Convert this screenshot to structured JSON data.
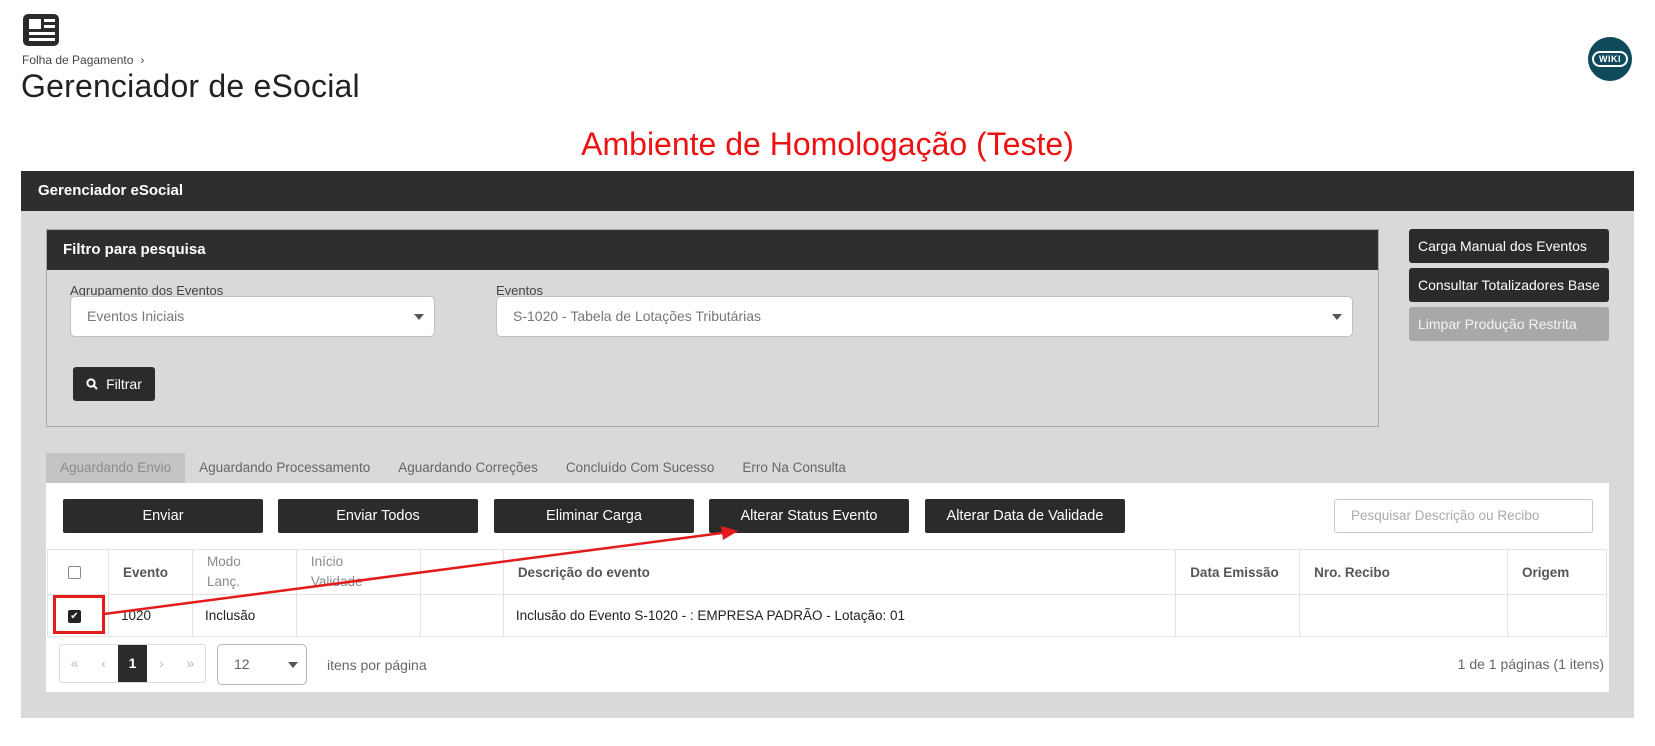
{
  "header": {
    "app_icon": "newspaper-icon",
    "breadcrumb": [
      "Folha de Pagamento"
    ],
    "page_title": "Gerenciador de eSocial",
    "wiki_label": "WIKI"
  },
  "environment_banner": {
    "text": "Ambiente de Homologação (Teste)",
    "color": "#ee1111"
  },
  "main_panel": {
    "title": "Gerenciador eSocial"
  },
  "filter": {
    "title": "Filtro para pesquisa",
    "grouping_label": "Agrupamento dos Eventos",
    "grouping_value": "Eventos Iniciais",
    "events_label": "Eventos",
    "events_value": "S-1020 - Tabela de Lotações Tributárias",
    "filter_button": "Filtrar"
  },
  "side_buttons": {
    "manual_load": "Carga Manual dos Eventos",
    "totalizers": "Consultar Totalizadores Base",
    "clear_restricted": "Limpar Produção Restrita"
  },
  "tabs": [
    {
      "label": "Aguardando Envio",
      "active": true
    },
    {
      "label": "Aguardando Processamento",
      "active": false
    },
    {
      "label": "Aguardando Correções",
      "active": false
    },
    {
      "label": "Concluído Com Sucesso",
      "active": false
    },
    {
      "label": "Erro Na Consulta",
      "active": false
    }
  ],
  "actions": {
    "send": "Enviar",
    "send_all": "Enviar Todos",
    "remove_load": "Eliminar Carga",
    "change_status": "Alterar Status Evento",
    "change_validity": "Alterar Data de Validade",
    "search_placeholder": "Pesquisar Descrição ou Recibo"
  },
  "table": {
    "columns": {
      "evento": "Evento",
      "modo": "Modo\nLanç.",
      "inicio": "Início\nValidade",
      "descricao": "Descrição do evento",
      "data_emissao": "Data Emissão",
      "nro_recibo": "Nro. Recibo",
      "origem": "Origem"
    },
    "rows": [
      {
        "checked": true,
        "evento": "1020",
        "modo": "Inclusão",
        "inicio": "",
        "descricao": "Inclusão do Evento S-1020 - : EMPRESA PADRÃO - Lotação: 01",
        "data_emissao": "",
        "nro_recibo": "",
        "origem": ""
      }
    ]
  },
  "pagination": {
    "first": "«",
    "prev": "‹",
    "current_page": "1",
    "next": "›",
    "last": "»",
    "per_page": "12",
    "per_page_label": "itens por página",
    "info": "1 de 1 páginas (1 itens)"
  },
  "annotation": {
    "color": "#e41b1b"
  }
}
